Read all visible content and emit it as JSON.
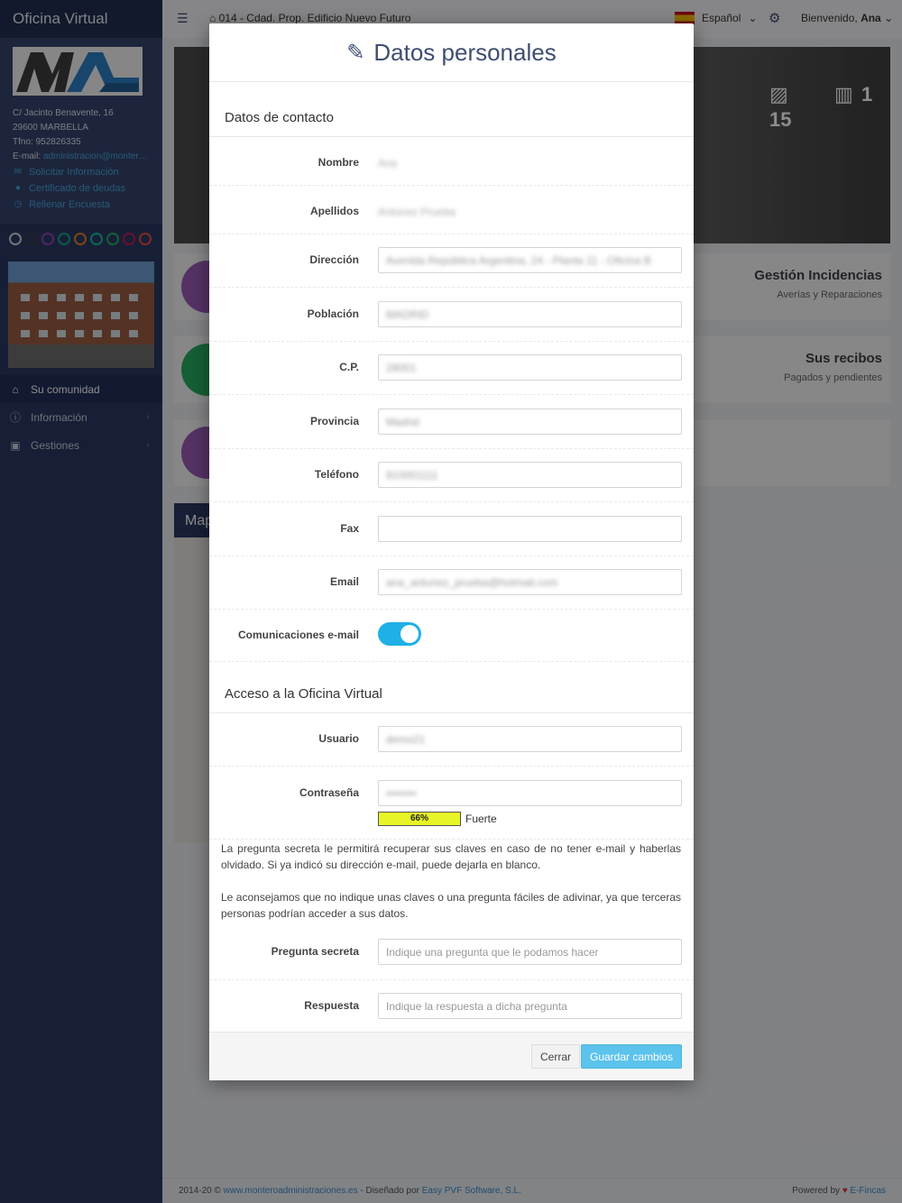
{
  "app": {
    "title": "Oficina Virtual"
  },
  "sidebar": {
    "address_lines": [
      "C/ Jacinto Benavente, 16",
      "29600 MARBELLA",
      "Tfno: 952826335"
    ],
    "email_label": "E-mail:",
    "email": "administracion@monter…",
    "links": [
      {
        "icon": "info-icon",
        "label": "Solicitar Información"
      },
      {
        "icon": "certificate-icon",
        "label": "Certificado de deudas"
      },
      {
        "icon": "survey-icon",
        "label": "Rellenar Encuesta"
      }
    ],
    "theme_colors": [
      "#cfd4e0",
      "#3a3a3a",
      "#8e44ad",
      "#16a085",
      "#e67e22",
      "#1abc9c",
      "#27ae60",
      "#c2185b",
      "#e74c3c"
    ],
    "menu": [
      {
        "icon": "home-icon",
        "label": "Su comunidad",
        "active": true
      },
      {
        "icon": "info-circle-icon",
        "label": "Información",
        "active": false
      },
      {
        "icon": "briefcase-icon",
        "label": "Gestiones",
        "active": false
      }
    ]
  },
  "topbar": {
    "breadcrumb": "014 - Cdad. Prop. Edificio Nuevo Futuro",
    "language": "Español",
    "welcome_prefix": "Bienvenido,",
    "user_name": "Ana"
  },
  "background": {
    "hero_photos": "15",
    "hero_videos": "1",
    "cards": [
      {
        "title": "Gestión Incidencias",
        "subtitle": "Averías y Reparaciones",
        "color": "#9b59b6"
      },
      {
        "title": "Sus recibos",
        "subtitle": "Pagados y pendientes",
        "color": "#27ae60"
      },
      {
        "title": "",
        "subtitle": "",
        "color": "#9b59b6"
      }
    ],
    "map_title": "Map"
  },
  "modal": {
    "title": "Datos personales",
    "section_contact": "Datos de contacto",
    "fields": {
      "nombre": {
        "label": "Nombre",
        "value": "Ana"
      },
      "apellidos": {
        "label": "Apellidos",
        "value": "Antúnez Prueba"
      },
      "direccion": {
        "label": "Dirección",
        "value": "Avenida República Argentina, 24 - Planta 11 - Oficina B"
      },
      "poblacion": {
        "label": "Población",
        "value": "MADRID"
      },
      "cp": {
        "label": "C.P.",
        "value": "28001"
      },
      "provincia": {
        "label": "Provincia",
        "value": "Madrid"
      },
      "telefono": {
        "label": "Teléfono",
        "value": "910001111"
      },
      "fax": {
        "label": "Fax",
        "value": ""
      },
      "email": {
        "label": "Email",
        "value": "ana_antunez_prueba@hotmail.com"
      },
      "comunicaciones": {
        "label": "Comunicaciones e-mail",
        "checked": true
      }
    },
    "section_access": "Acceso a la Oficina Virtual",
    "usuario": {
      "label": "Usuario",
      "value": "demo21"
    },
    "contrasena": {
      "label": "Contraseña",
      "value": "••••••••"
    },
    "strength": {
      "percent_label": "66%",
      "text": "Fuerte",
      "value": 0.66
    },
    "help_text_1": "La pregunta secreta le permitirá recuperar sus claves en caso de no tener e-mail y haberlas olvidado. Si ya indicó su dirección e-mail, puede dejarla en blanco.",
    "help_text_2": "Le aconsejamos que no indique unas claves o una pregunta fáciles de adivinar, ya que terceras personas podrían acceder a sus datos.",
    "pregunta": {
      "label": "Pregunta secreta",
      "placeholder": "Indique una pregunta que le podamos hacer"
    },
    "respuesta": {
      "label": "Respuesta",
      "placeholder": "Indique la respuesta a dicha pregunta"
    },
    "buttons": {
      "close": "Cerrar",
      "save": "Guardar cambios"
    }
  },
  "footer": {
    "copyright": "2014-20 ©",
    "site_link": "www.monteroadministraciones.es",
    "designed_by": "- Diseñado por",
    "designer_link": "Easy PVF Software, S.L.",
    "powered_by": "Powered by",
    "powered_link": "E-Fincas"
  }
}
